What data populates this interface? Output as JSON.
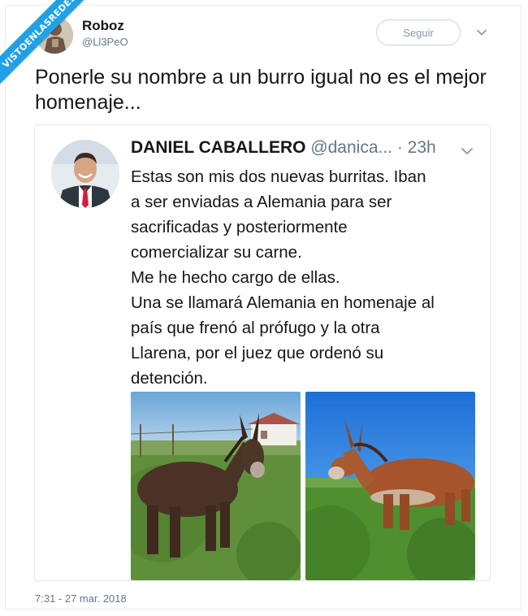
{
  "watermark": {
    "text": "VISTOENLASREDES"
  },
  "tweet": {
    "author_name": "Roboz",
    "author_handle": "@Ll3PeO",
    "follow_label": "Seguir",
    "text": "Ponerle su nombre a un burro igual no es el mejor homenaje...",
    "timestamp": "7:31 - 27 mar. 2018"
  },
  "quoted_tweet": {
    "author_name": "DANIEL CABALLERO",
    "author_handle": "@danica...",
    "time_ago": "· 23h",
    "text_lines": [
      "Estas son mis dos nuevas burritas. Iban",
      "a ser enviadas a Alemania para ser",
      "sacrificadas y posteriormente",
      "comercializar su carne.",
      "Me he hecho cargo de ellas.",
      "Una se llamará Alemania en homenaje al",
      "país que frenó al prófugo y la otra",
      "Llarena, por el juez que ordenó su",
      "detención."
    ]
  },
  "colors": {
    "accent": "#1ea1e6",
    "text_primary": "#14171a",
    "text_secondary": "#657786",
    "border": "#e1e8ed"
  },
  "icons": {
    "caret": "chevron-down-icon",
    "avatar": "avatar"
  }
}
